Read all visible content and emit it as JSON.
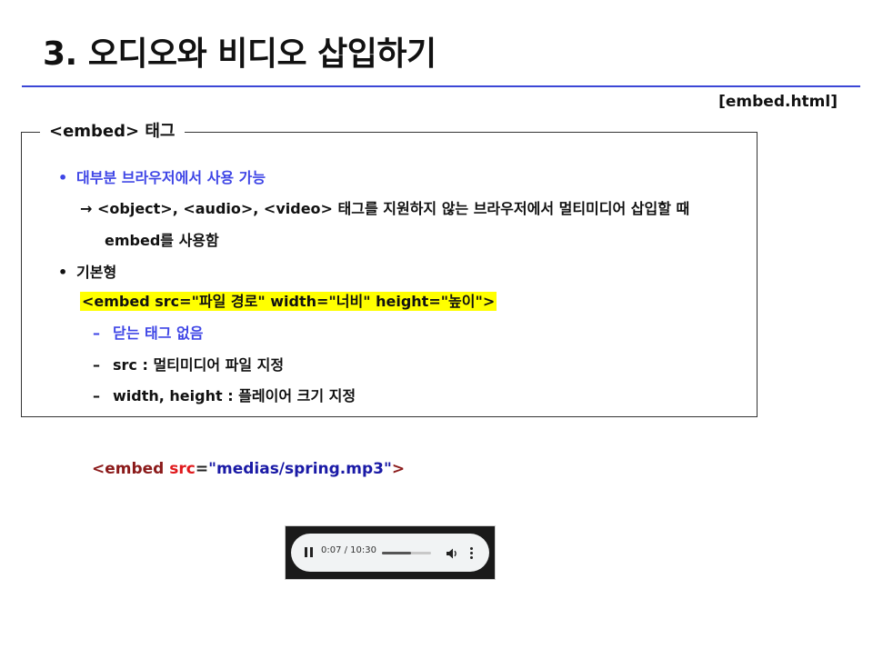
{
  "slide": {
    "title": "3. 오디오와 비디오 삽입하기",
    "file_label": "[embed.html]",
    "box_title": "<embed> 태그",
    "items": {
      "bullet1": "대부분 브라우저에서 사용 가능",
      "arrow_line1": "→ <object>, <audio>, <video> 태그를 지원하지 않는 브라우저에서 멀티미디어 삽입할 때",
      "arrow_line2": "embed를 사용함",
      "bullet2": "기본형",
      "syntax": "<embed src=\"파일 경로\" width=\"너비\" height=\"높이\">",
      "sub1": "닫는 태그 없음",
      "sub2": "src : 멀티미디어 파일 지정",
      "sub3": "width, height : 플레이어 크기 지정"
    },
    "bullet_symbol": "•",
    "dash_symbol": "–"
  },
  "code_example": {
    "open": "<embed ",
    "attr": "src",
    "eq": "=",
    "value": "\"medias/spring.mp3\"",
    "close": ">"
  },
  "audio_player": {
    "time_display": "0:07 / 10:30",
    "progress": 0.6,
    "state": "playing",
    "icons": [
      "pause-icon",
      "volume-icon",
      "more-options-icon"
    ]
  },
  "colors": {
    "accent_blue": "#3f46e6",
    "title_rule": "#3b47d6",
    "highlight": "#ffff00",
    "code_tag": "#8b1a1a",
    "code_attr": "#e0191c",
    "code_value": "#1a1aa6"
  }
}
